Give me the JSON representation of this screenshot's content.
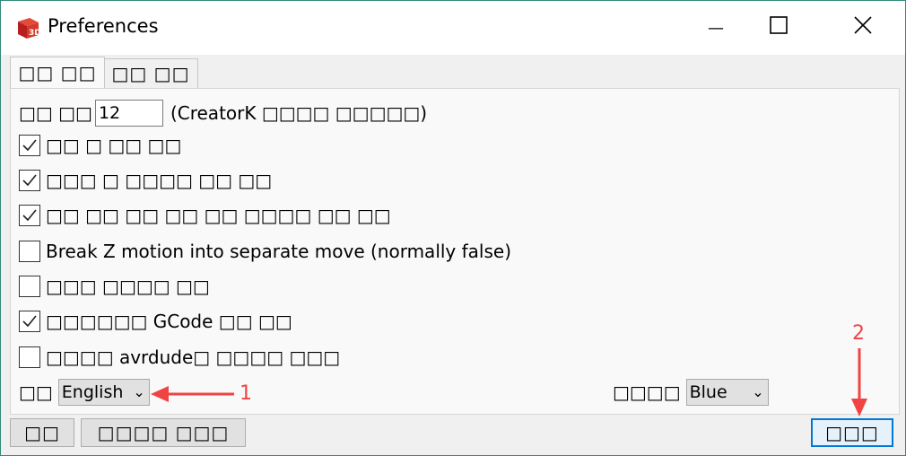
{
  "window": {
    "title": "Preferences",
    "app_icon": "3d-logo-icon",
    "minimize_glyph": "—",
    "maximize_glyph": "☐",
    "close_glyph": "✕"
  },
  "tabs": [
    {
      "label": "□□ □□",
      "active": true
    },
    {
      "label": "□□ □□",
      "active": false
    }
  ],
  "settings": {
    "font_size_label": "□□ □□",
    "font_size_value": "12",
    "font_size_note": "(CreatorK □□□□ □□□□□)",
    "checkboxes": [
      {
        "label": "□□ □ □□ □□",
        "checked": true
      },
      {
        "label": "□□□ □ □□□□ □□ □□",
        "checked": true
      },
      {
        "label": "□□ □□ □□ □□ □□ □□□□ □□ □□",
        "checked": true
      },
      {
        "label": "Break Z motion into separate move (normally false)",
        "checked": false
      },
      {
        "label": "□□□ □□□□ □□",
        "checked": false
      },
      {
        "label": "□□□□□□ GCode □□ □□",
        "checked": true
      },
      {
        "label": "□□□□ avrdude□ □□□□ □□□",
        "checked": false
      }
    ],
    "language_label": "□□",
    "language_value": "English",
    "theme_label": "□□□□",
    "theme_value": "Blue"
  },
  "buttons": {
    "left1": "□□",
    "left2": "□□□□ □□□",
    "ok": "□□□"
  },
  "annotations": {
    "label1": "1",
    "label2": "2",
    "color": "#f04444"
  }
}
